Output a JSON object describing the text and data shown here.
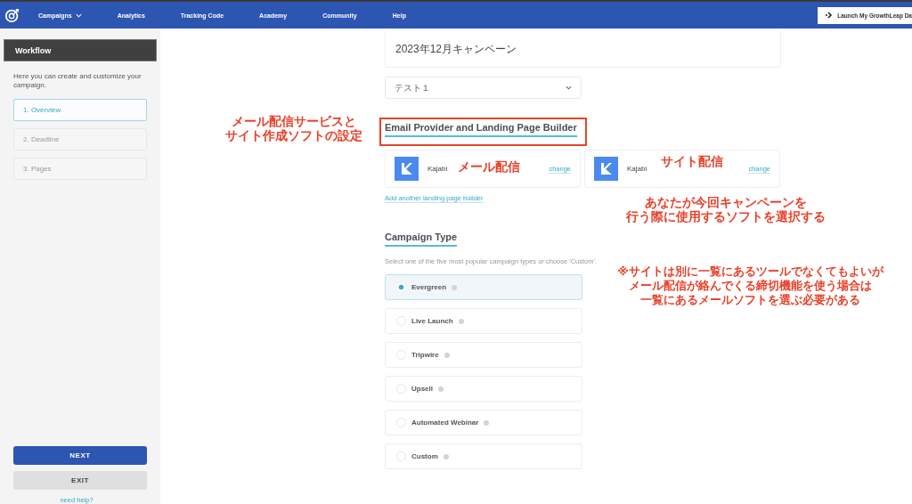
{
  "nav": {
    "items": [
      {
        "label": "Campaigns",
        "dropdown": true
      },
      {
        "label": "Analytics",
        "dropdown": false
      },
      {
        "label": "Tracking Code",
        "dropdown": false
      },
      {
        "label": "Academy",
        "dropdown": false
      },
      {
        "label": "Community",
        "dropdown": false
      },
      {
        "label": "Help",
        "dropdown": false
      }
    ],
    "launch_button": "Launch My GrowthLeap Da"
  },
  "sidebar": {
    "title": "Workflow",
    "description": "Here you can create and customize your campaign.",
    "steps": [
      {
        "label": "1. Overview",
        "selected": true
      },
      {
        "label": "2. Deadline",
        "selected": false
      },
      {
        "label": "3. Pages",
        "selected": false
      }
    ],
    "next_button": "NEXT",
    "exit_button": "EXIT",
    "help_link": "need help?"
  },
  "campaign_name": {
    "value": "2023年12月キャンペーン"
  },
  "select": {
    "value": "テスト１"
  },
  "providers": {
    "heading": "Email Provider and Landing Page Builder",
    "cards": [
      {
        "name": "Kajabi",
        "action": "change"
      },
      {
        "name": "Kajabi",
        "action": "change"
      }
    ],
    "add_link": "Add another landing page builder"
  },
  "campaign_type": {
    "heading": "Campaign Type",
    "description": "Select one of the five most popular campaign types or choose 'Custom'.",
    "options": [
      {
        "label": "Evergreen",
        "selected": true
      },
      {
        "label": "Live Launch",
        "selected": false
      },
      {
        "label": "Tripwire",
        "selected": false
      },
      {
        "label": "Upsell",
        "selected": false
      },
      {
        "label": "Automated Webinar",
        "selected": false
      },
      {
        "label": "Custom",
        "selected": false
      }
    ]
  },
  "annotations": [
    {
      "kind": "note",
      "lines": [
        "メール配信サービスと",
        "サイト作成ソフトの設定"
      ]
    },
    {
      "kind": "note",
      "lines": [
        "メール配信"
      ]
    },
    {
      "kind": "note",
      "lines": [
        "サイト配信"
      ]
    },
    {
      "kind": "note",
      "lines": [
        "あなたが今回キャンペーンを",
        "行う際に使用するソフトを選択する"
      ]
    },
    {
      "kind": "note",
      "lines": [
        "※サイトは別に一覧にあるツールでなくてもよいが",
        "メール配信が絡んでくる締切機能を使う場合は",
        "一覧にあるメールソフトを選ぶ必要がある"
      ]
    },
    {
      "kind": "box"
    }
  ]
}
